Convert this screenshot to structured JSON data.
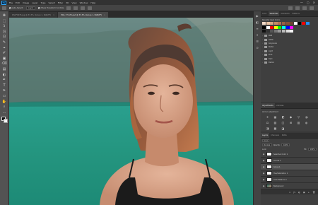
{
  "app": {
    "logo": "Ps"
  },
  "menu": [
    "File",
    "Edit",
    "Image",
    "Layer",
    "Type",
    "Select",
    "Filter",
    "3D",
    "View",
    "Window",
    "Help"
  ],
  "window_controls": [
    "—",
    "▢",
    "✕"
  ],
  "options": {
    "auto_select_label": "Auto-Select:",
    "auto_select_value": "Layer",
    "show_transform_label": "Show Transform Controls"
  },
  "tabs": [
    {
      "label": "DSCF0035.jpg @ 33.3% (Group 1, RGB/8*)",
      "active": false
    },
    {
      "label": "IMG_771-Ed.psd @ 33.3% (Group 1, RGB/8*)",
      "active": true
    }
  ],
  "tab_close": "×",
  "tools": [
    "✥",
    "⬚",
    "ʖ",
    "◳",
    "⊡",
    "✎",
    "⌖",
    "✐",
    "▣",
    "⌫",
    "▤",
    "◐",
    "✒",
    "T",
    "➤",
    "▭",
    "✋",
    "⌕",
    "…"
  ],
  "panel_strip_icons": [
    "▶",
    "◧",
    "≡",
    "✦",
    "☰",
    "⊙"
  ],
  "color_panel": {
    "tabs": [
      "Color",
      "Swatches",
      "Gradients",
      "Patterns"
    ],
    "active": "Swatches",
    "recent_label": "Recently Used Colors",
    "recent_colors": [
      "#f2d9c6",
      "#e8c3a4",
      "#d7a583",
      "#c48a66",
      "#b07453",
      "#9a5f42",
      "#86503a",
      "#6d4331",
      "#ffffff",
      "#000000",
      "#ff0000",
      "#1e90ff"
    ],
    "basic_colors": [
      "#000000",
      "#ffffff",
      "#ff0000",
      "#ffff00",
      "#00ff00",
      "#00ffff",
      "#0000ff",
      "#ff00ff"
    ],
    "grays": [
      "#111111",
      "#333333",
      "#555555",
      "#777777",
      "#999999",
      "#bbbbbb",
      "#dddddd",
      "#f5f5f5"
    ],
    "folders": [
      "RGB",
      "CMYK",
      "Grayscale",
      "Pastel",
      "Light",
      "Pure",
      "Dark",
      "Darker"
    ]
  },
  "adjustments": {
    "tabs": [
      "Adjustments",
      "Libraries"
    ],
    "active": "Adjustments",
    "add_label": "Add an adjustment",
    "icons": [
      "☀",
      "▦",
      "◩",
      "◆",
      "▽",
      "◑",
      "⚖",
      "▧",
      "◫",
      "⊞",
      "▥",
      "◍",
      "◨",
      "▩",
      "◪"
    ]
  },
  "layers": {
    "tabs": [
      "Layers",
      "Channels",
      "Paths"
    ],
    "active": "Layers",
    "kind_label": "Kind",
    "blend_mode": "Normal",
    "opacity_label": "Opacity:",
    "opacity": "100%",
    "lock_label": "Lock:",
    "fill_label": "Fill:",
    "fill": "100%",
    "rows": [
      {
        "name": "Selective Color 1",
        "thumb": "mask",
        "selected": false
      },
      {
        "name": "Curves 1",
        "thumb": "mask",
        "selected": false
      },
      {
        "name": "Group 1",
        "thumb": "mask",
        "selected": true
      },
      {
        "name": "Hue/Saturation 1",
        "thumb": "mask",
        "selected": false
      },
      {
        "name": "Color Balance 1",
        "thumb": "mask",
        "selected": false
      },
      {
        "name": "Background",
        "thumb": "photo",
        "selected": false
      }
    ],
    "footer_icons": [
      "∞",
      "ƒx",
      "◐",
      "▣",
      "+",
      "🗑"
    ]
  }
}
